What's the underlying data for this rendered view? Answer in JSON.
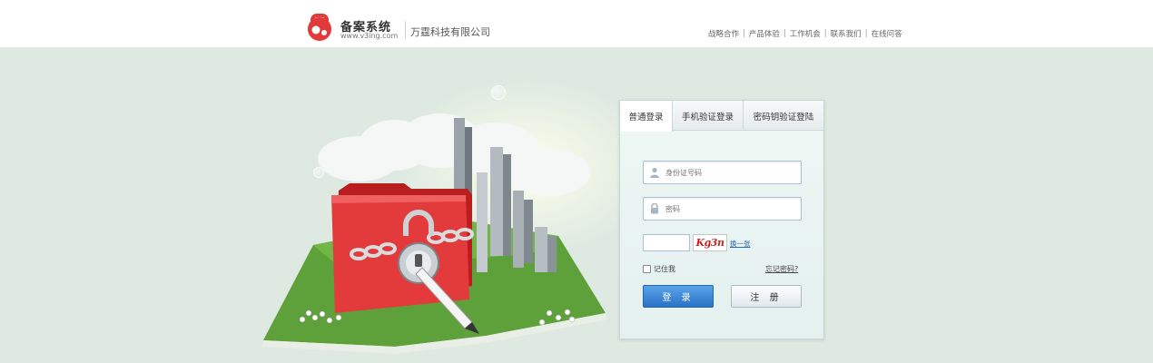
{
  "header": {
    "title": "备案系统",
    "url": "www.v3ing.com",
    "company": "万霆科技有限公司",
    "nav": [
      "战略合作",
      "产品体验",
      "工作机会",
      "联系我们",
      "在线问答"
    ]
  },
  "login": {
    "tabs": [
      {
        "label": "普通登录",
        "active": true
      },
      {
        "label": "手机验证登录",
        "active": false
      },
      {
        "label": "密码钥验证登陆",
        "active": false
      }
    ],
    "id_placeholder": "身份证号码",
    "password_placeholder": "密码",
    "captcha_text": "Kg3n",
    "refresh_label": "换一张",
    "remember_label": "记住我",
    "forgot_label": "忘记密码?",
    "login_button": "登 录",
    "register_button": "注 册"
  },
  "colors": {
    "brand_red": "#e23a3a",
    "login_button": "#3a83d6",
    "background": "#dde9e1"
  }
}
